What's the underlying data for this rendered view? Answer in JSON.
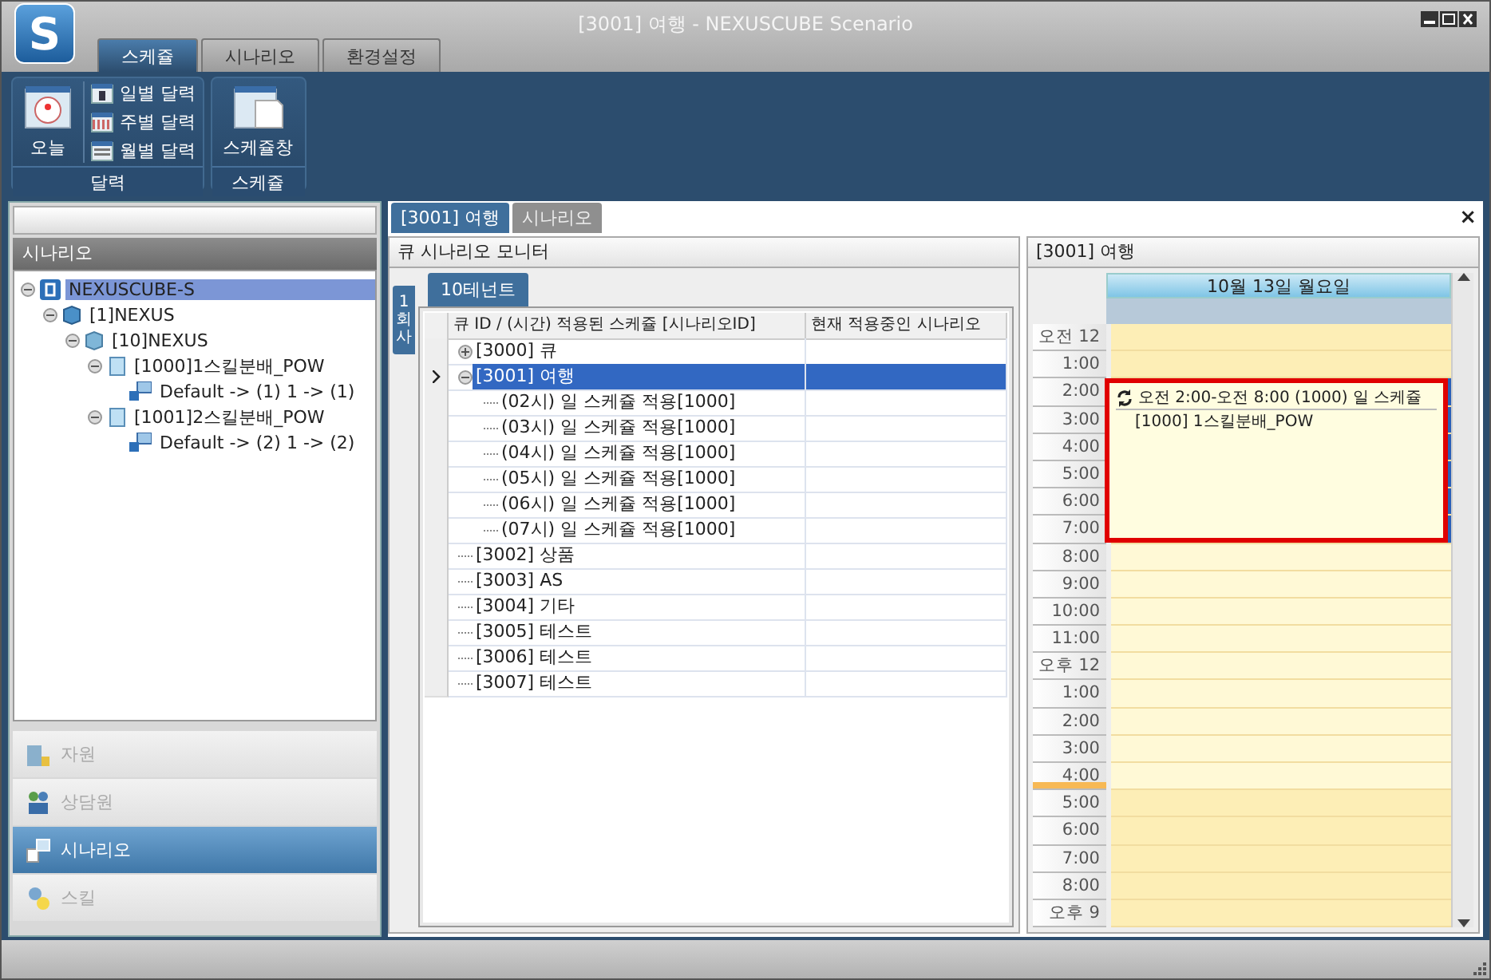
{
  "window": {
    "logo": "S",
    "title": "[3001] 여행 - NEXUSCUBE Scenario"
  },
  "menu_tabs": [
    {
      "label": "스케쥴",
      "selected": true
    },
    {
      "label": "시나리오",
      "selected": false
    },
    {
      "label": "환경설정",
      "selected": false
    }
  ],
  "ribbon": {
    "groups": [
      {
        "label": "달력",
        "large": [
          {
            "label": "오늘",
            "kind": "today"
          }
        ],
        "small": [
          {
            "label": "일별 달력",
            "kind": "day"
          },
          {
            "label": "주별 달력",
            "kind": "week"
          },
          {
            "label": "월별 달력",
            "kind": "month"
          }
        ]
      },
      {
        "label": "스케쥴",
        "large": [
          {
            "label": "스케쥴창",
            "kind": "schedule"
          }
        ]
      }
    ]
  },
  "sidebar": {
    "title": "시나리오",
    "tree": [
      {
        "label": "NEXUSCUBE-S",
        "kind": "root",
        "selected": true,
        "children": [
          {
            "label": "[1]NEXUS",
            "kind": "company",
            "selected": false,
            "children": [
              {
                "label": "[10]NEXUS",
                "kind": "tenant",
                "selected": false,
                "children": [
                  {
                    "label": "[1000]1스킬분배_POW",
                    "kind": "scenario",
                    "selected": false,
                    "children": [
                      {
                        "label": "Default -> (1)  1 -> (1)",
                        "kind": "rule",
                        "selected": false
                      }
                    ]
                  },
                  {
                    "label": "[1001]2스킬분배_POW",
                    "kind": "scenario",
                    "selected": false,
                    "children": [
                      {
                        "label": "Default -> (2)  1 -> (2)",
                        "kind": "rule",
                        "selected": false
                      }
                    ]
                  }
                ]
              }
            ]
          }
        ]
      }
    ],
    "nav": [
      {
        "label": "자원",
        "kind": "resource",
        "selected": false
      },
      {
        "label": "상담원",
        "kind": "agent",
        "selected": false
      },
      {
        "label": "시나리오",
        "kind": "scenario",
        "selected": true
      },
      {
        "label": "스킬",
        "kind": "skill",
        "selected": false
      }
    ]
  },
  "doc_tabs": [
    {
      "label": "[3001] 여행",
      "selected": true
    },
    {
      "label": "시나리오",
      "selected": false
    }
  ],
  "close": "×",
  "monitor": {
    "title": "큐 시나리오 모니터",
    "side_tab": "1회사",
    "tenant_tab": "10테넌트",
    "columns": [
      "큐 ID / (시간) 적용된 스케쥴 [시나리오ID]",
      "현재 적용중인 시나리오"
    ],
    "rows": [
      {
        "label": "[3000] 큐",
        "expanded": false,
        "selected": false
      },
      {
        "label": "[3001] 여행",
        "expanded": true,
        "selected": true,
        "children": [
          {
            "label": "(02시) 일 스케쥴 적용[1000]",
            "selected": false
          },
          {
            "label": "(03시) 일 스케쥴 적용[1000]",
            "selected": false
          },
          {
            "label": "(04시) 일 스케쥴 적용[1000]",
            "selected": false
          },
          {
            "label": "(05시) 일 스케쥴 적용[1000]",
            "selected": false
          },
          {
            "label": "(06시) 일 스케쥴 적용[1000]",
            "selected": false
          },
          {
            "label": "(07시) 일 스케쥴 적용[1000]",
            "selected": false
          }
        ]
      },
      {
        "label": "[3002] 상품",
        "selected": false
      },
      {
        "label": "[3003] AS",
        "selected": false
      },
      {
        "label": "[3004] 기타",
        "selected": false
      },
      {
        "label": "[3005] 테스트",
        "selected": false
      },
      {
        "label": "[3006] 테스트",
        "selected": false
      },
      {
        "label": "[3007] 테스트",
        "selected": false
      }
    ]
  },
  "calendar": {
    "title": "[3001] 여행",
    "day": "10월 13일 월요일",
    "slots": [
      {
        "label": "오전 12",
        "work": false,
        "busy": false,
        "now": false
      },
      {
        "label": "1:00",
        "work": false,
        "busy": false,
        "now": false
      },
      {
        "label": "2:00",
        "work": false,
        "busy": true,
        "now": false
      },
      {
        "label": "3:00",
        "work": false,
        "busy": true,
        "now": false
      },
      {
        "label": "4:00",
        "work": false,
        "busy": true,
        "now": false
      },
      {
        "label": "5:00",
        "work": false,
        "busy": true,
        "now": false
      },
      {
        "label": "6:00",
        "work": false,
        "busy": true,
        "now": false
      },
      {
        "label": "7:00",
        "work": false,
        "busy": true,
        "now": false
      },
      {
        "label": "8:00",
        "work": true,
        "busy": false,
        "now": false
      },
      {
        "label": "9:00",
        "work": true,
        "busy": false,
        "now": false
      },
      {
        "label": "10:00",
        "work": true,
        "busy": false,
        "now": false
      },
      {
        "label": "11:00",
        "work": true,
        "busy": false,
        "now": false
      },
      {
        "label": "오후 12",
        "work": true,
        "busy": false,
        "now": false
      },
      {
        "label": "1:00",
        "work": true,
        "busy": false,
        "now": false
      },
      {
        "label": "2:00",
        "work": true,
        "busy": false,
        "now": false
      },
      {
        "label": "3:00",
        "work": true,
        "busy": false,
        "now": false
      },
      {
        "label": "4:00",
        "work": true,
        "busy": false,
        "now": true
      },
      {
        "label": "5:00",
        "work": false,
        "busy": false,
        "now": false
      },
      {
        "label": "6:00",
        "work": false,
        "busy": false,
        "now": false
      },
      {
        "label": "7:00",
        "work": false,
        "busy": false,
        "now": false
      },
      {
        "label": "8:00",
        "work": false,
        "busy": false,
        "now": false
      },
      {
        "label": "오후 9",
        "work": false,
        "busy": false,
        "now": false
      }
    ],
    "appointment": {
      "title": "오전 2:00-오전 8:00 (1000) 일 스케쥴",
      "body": "[1000] 1스킬분배_POW",
      "selected": true,
      "recurring": true
    }
  }
}
